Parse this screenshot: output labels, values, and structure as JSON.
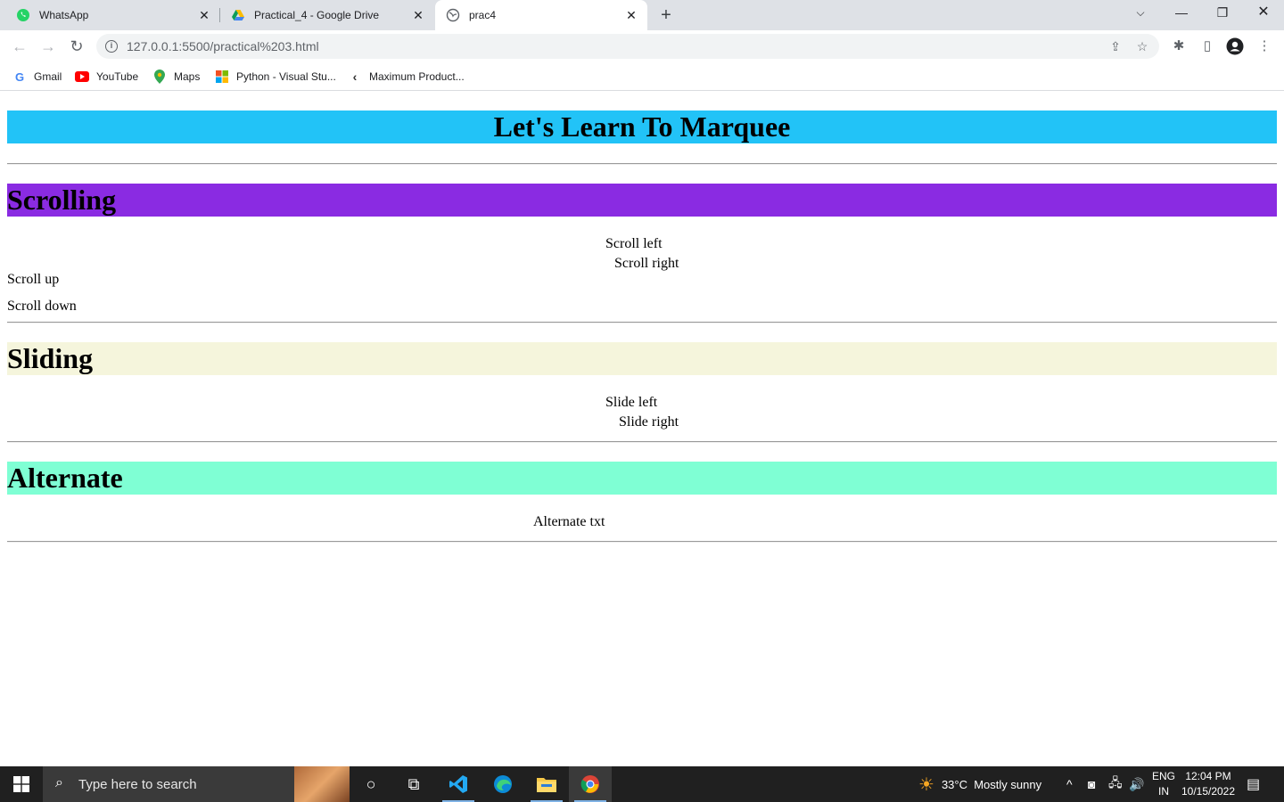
{
  "browser": {
    "tabs": [
      {
        "title": "WhatsApp",
        "icon": "whatsapp-icon",
        "active": false
      },
      {
        "title": "Practical_4 - Google Drive",
        "icon": "google-drive-icon",
        "active": false
      },
      {
        "title": "prac4",
        "icon": "globe-icon",
        "active": true
      }
    ],
    "url": "127.0.0.1:5500/practical%203.html",
    "bookmarks": [
      {
        "label": "Gmail",
        "icon": "google-icon"
      },
      {
        "label": "YouTube",
        "icon": "youtube-icon"
      },
      {
        "label": "Maps",
        "icon": "maps-icon"
      },
      {
        "label": "Python - Visual Stu...",
        "icon": "microsoft-icon"
      },
      {
        "label": "Maximum Product...",
        "icon": "code-icon"
      }
    ]
  },
  "page": {
    "title": "Let's Learn To Marquee",
    "sections": [
      {
        "heading": "Scrolling",
        "color": "#8a2be2",
        "items": [
          "Scroll left",
          "Scroll right",
          "Scroll up",
          "Scroll down"
        ]
      },
      {
        "heading": "Sliding",
        "color": "#f5f5dc",
        "items": [
          "Slide left",
          "Slide right"
        ]
      },
      {
        "heading": "Alternate",
        "color": "#7fffd4",
        "items": [
          "Alternate txt"
        ]
      }
    ],
    "title_color": "#22c3f7"
  },
  "taskbar": {
    "search_placeholder": "Type here to search",
    "weather": "33°C  Mostly sunny",
    "lang_top": "ENG",
    "lang_bottom": "IN",
    "time": "12:04 PM",
    "date": "10/15/2022"
  }
}
